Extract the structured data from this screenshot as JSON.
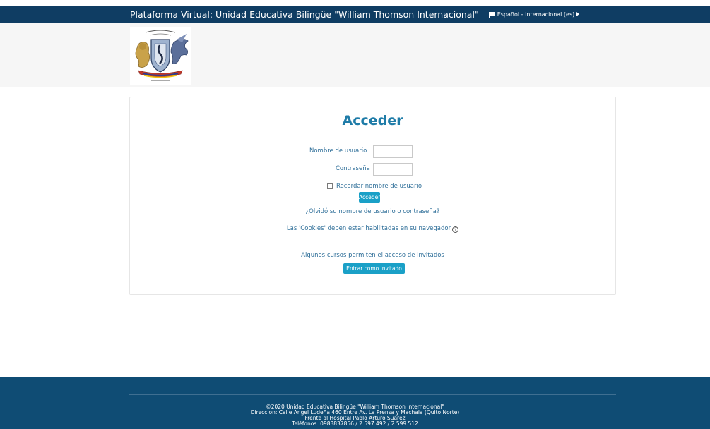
{
  "topbar": {
    "site_title": "Plataforma Virtual: Unidad Educativa Bilingüe \"William Thomson Internacional\"",
    "language": "Español - Internacional (es)"
  },
  "logo": {
    "alt": "Logo Unidad Educativa Bilingüe William Thomson Internacional"
  },
  "login": {
    "title": "Acceder",
    "username_label": "Nombre de usuario",
    "username_value": "",
    "password_label": "Contraseña",
    "password_value": "",
    "remember_label": "Recordar nombre de usuario",
    "submit_label": "Acceder",
    "forgot_link": "¿Olvidó su nombre de usuario o contraseña?",
    "cookies_notice": "Las 'Cookies' deben estar habilitadas en su navegador",
    "guest_notice": "Algunos cursos permiten el acceso de invitados",
    "guest_button": "Entrar como invitado"
  },
  "footer": {
    "copyright": "©2020 Unidad Educativa Bilingüe \"William Thomson Internacional\"",
    "address": "Direccion: Calle Angel Ludeña 460 Entre Av. La Prensa y Machala (Quito Norte)",
    "reference": "Frente al Hospital Pablo Arturo Suárez",
    "phones": "Teléfonos: 0983837856 / 2 597 492 / 2 599 512"
  },
  "colors": {
    "topbar": "#0f3d63",
    "accent": "#1aa0c7",
    "link": "#2f6f99",
    "footer": "#0f4c74"
  }
}
